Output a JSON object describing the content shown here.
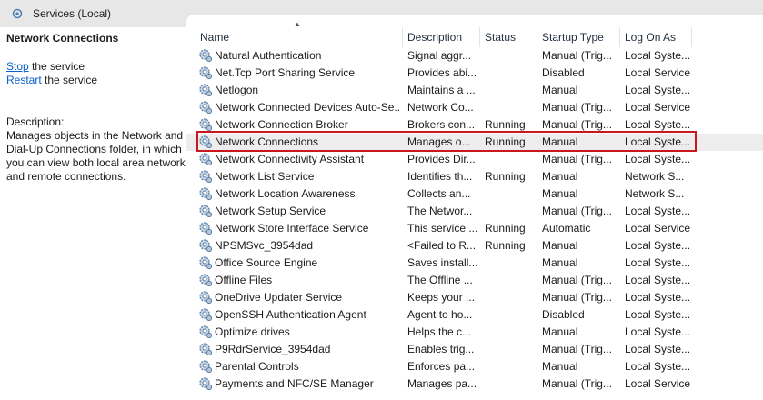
{
  "window": {
    "title": "Services (Local)",
    "icon": "services-gear-icon"
  },
  "left_pane": {
    "heading": "Network Connections",
    "stop_link": "Stop",
    "stop_suffix": " the service",
    "restart_link": "Restart",
    "restart_suffix": " the service",
    "description_label": "Description:",
    "description": "Manages objects in the Network and Dial-Up Connections folder, in which you can view both local area network and remote connections."
  },
  "columns": {
    "name": "Name",
    "description": "Description",
    "status": "Status",
    "startup": "Startup Type",
    "logon": "Log On As"
  },
  "highlight_color": "#c8171e",
  "services": [
    {
      "name": "Natural Authentication",
      "description": "Signal aggr...",
      "status": "",
      "startup": "Manual (Trig...",
      "logon": "Local Syste..."
    },
    {
      "name": "Net.Tcp Port Sharing Service",
      "description": "Provides abi...",
      "status": "",
      "startup": "Disabled",
      "logon": "Local Service"
    },
    {
      "name": "Netlogon",
      "description": "Maintains a ...",
      "status": "",
      "startup": "Manual",
      "logon": "Local Syste..."
    },
    {
      "name": "Network Connected Devices Auto-Se...",
      "description": "Network Co...",
      "status": "",
      "startup": "Manual (Trig...",
      "logon": "Local Service"
    },
    {
      "name": "Network Connection Broker",
      "description": "Brokers con...",
      "status": "Running",
      "startup": "Manual (Trig...",
      "logon": "Local Syste..."
    },
    {
      "name": "Network Connections",
      "description": "Manages o...",
      "status": "Running",
      "startup": "Manual",
      "logon": "Local Syste...",
      "selected": true
    },
    {
      "name": "Network Connectivity Assistant",
      "description": "Provides Dir...",
      "status": "",
      "startup": "Manual (Trig...",
      "logon": "Local Syste..."
    },
    {
      "name": "Network List Service",
      "description": "Identifies th...",
      "status": "Running",
      "startup": "Manual",
      "logon": "Network S..."
    },
    {
      "name": "Network Location Awareness",
      "description": "Collects an...",
      "status": "",
      "startup": "Manual",
      "logon": "Network S..."
    },
    {
      "name": "Network Setup Service",
      "description": "The Networ...",
      "status": "",
      "startup": "Manual (Trig...",
      "logon": "Local Syste..."
    },
    {
      "name": "Network Store Interface Service",
      "description": "This service ...",
      "status": "Running",
      "startup": "Automatic",
      "logon": "Local Service"
    },
    {
      "name": "NPSMSvc_3954dad",
      "description": "<Failed to R...",
      "status": "Running",
      "startup": "Manual",
      "logon": "Local Syste..."
    },
    {
      "name": "Office  Source Engine",
      "description": "Saves install...",
      "status": "",
      "startup": "Manual",
      "logon": "Local Syste..."
    },
    {
      "name": "Offline Files",
      "description": "The Offline ...",
      "status": "",
      "startup": "Manual (Trig...",
      "logon": "Local Syste..."
    },
    {
      "name": "OneDrive Updater Service",
      "description": "Keeps your ...",
      "status": "",
      "startup": "Manual (Trig...",
      "logon": "Local Syste..."
    },
    {
      "name": "OpenSSH Authentication Agent",
      "description": "Agent to ho...",
      "status": "",
      "startup": "Disabled",
      "logon": "Local Syste..."
    },
    {
      "name": "Optimize drives",
      "description": "Helps the c...",
      "status": "",
      "startup": "Manual",
      "logon": "Local Syste..."
    },
    {
      "name": "P9RdrService_3954dad",
      "description": "Enables trig...",
      "status": "",
      "startup": "Manual (Trig...",
      "logon": "Local Syste..."
    },
    {
      "name": "Parental Controls",
      "description": "Enforces pa...",
      "status": "",
      "startup": "Manual",
      "logon": "Local Syste..."
    },
    {
      "name": "Payments and NFC/SE Manager",
      "description": "Manages pa...",
      "status": "",
      "startup": "Manual (Trig...",
      "logon": "Local Service"
    }
  ]
}
